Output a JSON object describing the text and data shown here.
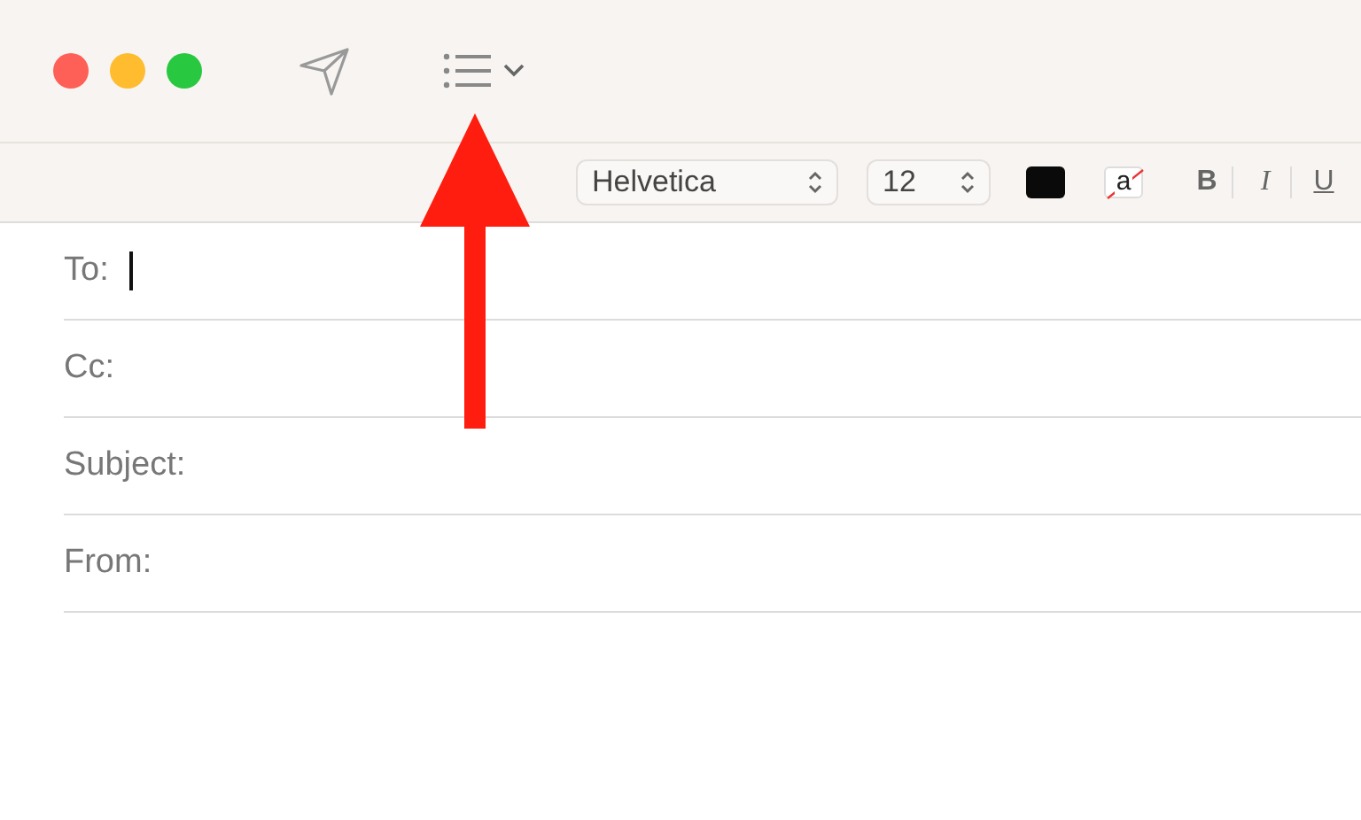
{
  "format_bar": {
    "font": "Helvetica",
    "size": "12",
    "bold": "B",
    "italic": "I",
    "underline": "U",
    "highlight_glyph": "a"
  },
  "fields": [
    {
      "label": "To:",
      "focused": true
    },
    {
      "label": "Cc:",
      "focused": false
    },
    {
      "label": "Subject:",
      "focused": false
    },
    {
      "label": "From:",
      "focused": false
    }
  ],
  "annotation": {
    "kind": "arrow"
  }
}
